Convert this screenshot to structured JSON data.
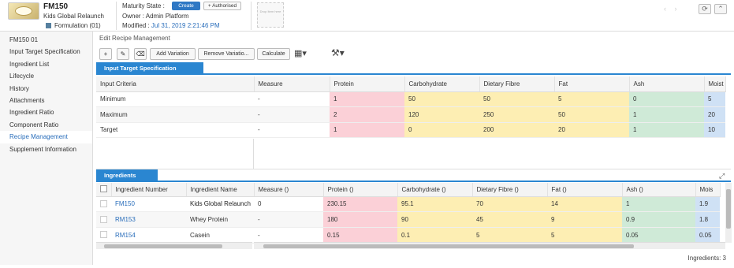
{
  "header": {
    "code": "FM150",
    "name": "Kids Global Relaunch",
    "formulation": "Formulation (01)",
    "maturity_label": "Maturity State :",
    "create_btn": "Create",
    "authorised_btn": "+ Authorised",
    "owner": "Owner : Admin Platform",
    "modified_label": "Modified : ",
    "modified_value": "Jul 31, 2019 2:21:46 PM",
    "drop_text": "Drop Item here"
  },
  "sidebar": {
    "items": [
      {
        "label": "FM150 01"
      },
      {
        "label": "Input Target Specification"
      },
      {
        "label": "Ingredient List"
      },
      {
        "label": "Lifecycle"
      },
      {
        "label": "History"
      },
      {
        "label": "Attachments"
      },
      {
        "label": "Ingredient Ratio"
      },
      {
        "label": "Component Ratio"
      },
      {
        "label": "Recipe Management",
        "active": true
      },
      {
        "label": "Supplement Information"
      }
    ]
  },
  "main": {
    "breadcrumb": "Edit Recipe Management",
    "toolbar": {
      "add_variation": "Add Variation",
      "remove_variation": "Remove Variatio...",
      "calculate": "Calculate"
    },
    "spec_section": {
      "title": "Input Target Specification",
      "columns": [
        "Input Criteria",
        "Measure",
        "Protein",
        "Carbohydrate",
        "Dietary Fibre",
        "Fat",
        "Ash",
        "Moist"
      ],
      "rows": [
        [
          "Minimum",
          "-",
          "1",
          "50",
          "50",
          "5",
          "0",
          "5"
        ],
        [
          "Maximum",
          "-",
          "2",
          "120",
          "250",
          "50",
          "1",
          "20"
        ],
        [
          "Target",
          "-",
          "1",
          "0",
          "200",
          "20",
          "1",
          "10"
        ]
      ]
    },
    "ingredients_section": {
      "title": "Ingredients",
      "columns": [
        "Ingredient Number",
        "Ingredient Name",
        "Measure ()",
        "Protein ()",
        "Carbohydrate ()",
        "Dietary Fibre ()",
        "Fat ()",
        "Ash ()",
        "Mois"
      ],
      "rows": [
        [
          "FM150",
          "Kids Global Relaunch",
          "0",
          "230.15",
          "95.1",
          "70",
          "14",
          "1",
          "1.9"
        ],
        [
          "RM153",
          "Whey Protein",
          "-",
          "180",
          "90",
          "45",
          "9",
          "0.9",
          "1.8"
        ],
        [
          "RM154",
          "Casein",
          "-",
          "0.15",
          "0.1",
          "5",
          "5",
          "0.05",
          "0.05"
        ]
      ],
      "count": "Ingredients: 3"
    }
  },
  "colors": {
    "accent": "#2a86d1",
    "protein": "#fbd0d7",
    "carbs_fibre_fat": "#fdeeb3",
    "ash": "#cfead7",
    "moisture": "#cfe1f5"
  }
}
